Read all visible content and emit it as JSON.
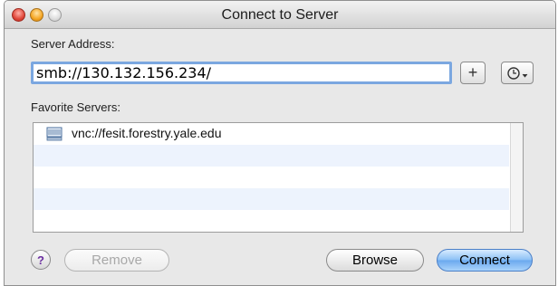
{
  "window": {
    "title": "Connect to Server"
  },
  "server_address": {
    "label": "Server Address:",
    "value": "smb://130.132.156.234/"
  },
  "add_button": {
    "label": "+"
  },
  "recent_button": {
    "icon": "clock-icon"
  },
  "favorites": {
    "label": "Favorite Servers:",
    "items": [
      {
        "label": "vnc://fesit.forestry.yale.edu",
        "icon": "server-icon"
      }
    ]
  },
  "buttons": {
    "help": "?",
    "remove": "Remove",
    "browse": "Browse",
    "connect": "Connect"
  },
  "colors": {
    "accent": "#7ba7e0",
    "default_button": "#6aa8ee",
    "row_alt": "#edf3fd"
  }
}
